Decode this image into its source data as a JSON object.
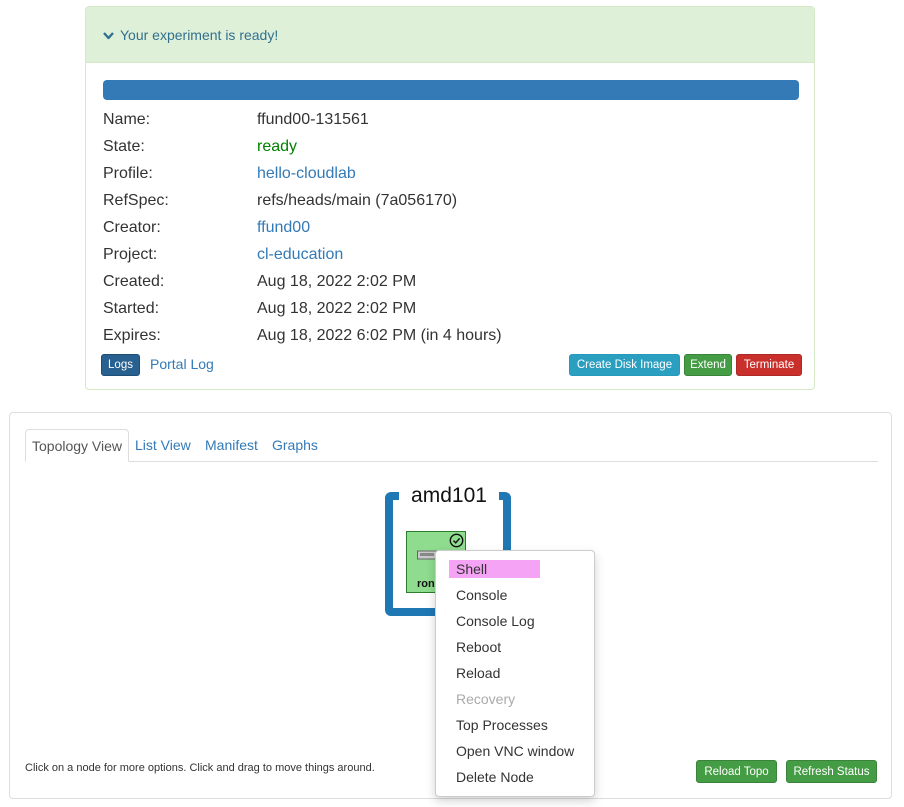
{
  "status": {
    "heading": "Your experiment is ready!",
    "progress": 1.0,
    "fields": [
      {
        "key": "Name:",
        "value": "ffund00-131561"
      },
      {
        "key": "State:",
        "value": "ready"
      },
      {
        "key": "Profile:",
        "value": "hello-cloudlab"
      },
      {
        "key": "RefSpec:",
        "value": "refs/heads/main (7a056170)"
      },
      {
        "key": "Creator:",
        "value": "ffund00"
      },
      {
        "key": "Project:",
        "value": "cl-education"
      },
      {
        "key": "Created:",
        "value": "Aug 18, 2022 2:02 PM"
      },
      {
        "key": "Started:",
        "value": "Aug 18, 2022 2:02 PM"
      },
      {
        "key": "Expires:",
        "value": "Aug 18, 2022 6:02 PM (in 4 hours)"
      }
    ],
    "buttons": {
      "logs": "Logs",
      "portal_log": "Portal Log",
      "create_disk_image": "Create Disk Image",
      "extend": "Extend",
      "terminate": "Terminate"
    }
  },
  "topology": {
    "tabs": [
      "Topology View",
      "List View",
      "Manifest",
      "Graphs"
    ],
    "site_label": "amd101",
    "node_label": "romeo",
    "node_label_visible": "ron",
    "help_text": "Click on a node for more options. Click and drag to move things around.",
    "buttons": {
      "reload_topo": "Reload Topo",
      "refresh_status": "Refresh Status"
    }
  },
  "context_menu": {
    "items": [
      {
        "label": "Shell",
        "state": "highlighted"
      },
      {
        "label": "Console",
        "state": "normal"
      },
      {
        "label": "Console Log",
        "state": "normal"
      },
      {
        "label": "Reboot",
        "state": "normal"
      },
      {
        "label": "Reload",
        "state": "normal"
      },
      {
        "label": "Recovery",
        "state": "disabled"
      },
      {
        "label": "Top Processes",
        "state": "normal"
      },
      {
        "label": "Open VNC window",
        "state": "normal"
      },
      {
        "label": "Delete Node",
        "state": "normal"
      }
    ]
  },
  "colors": {
    "ready_green": "#008000",
    "link_blue": "#337ab7",
    "site_blue": "#1f78b4",
    "node_green": "#8fdc8f",
    "highlight_pink": "#f5a3f5"
  },
  "icons": {
    "heading": "chevron-down-icon",
    "node_status": "check-circle-icon",
    "node_type": "server-icon"
  }
}
